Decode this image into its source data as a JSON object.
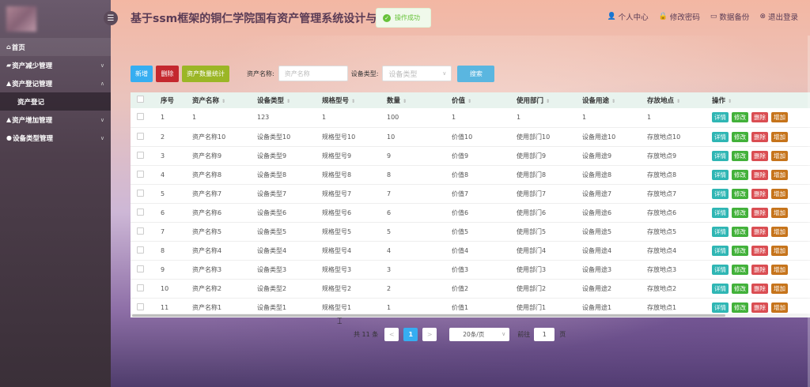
{
  "app": {
    "title": "基于ssm框架的铜仁学院国有资产管理系统设计与实现"
  },
  "toast": {
    "message": "操作成功"
  },
  "header_links": [
    {
      "icon": "user-icon",
      "label": "个人中心"
    },
    {
      "icon": "lock-icon",
      "label": "修改密码"
    },
    {
      "icon": "folder-icon",
      "label": "数据备份"
    },
    {
      "icon": "logout-icon",
      "label": "退出登录"
    }
  ],
  "sidebar": {
    "items": [
      {
        "label": "首页"
      },
      {
        "label": "资产减少管理"
      },
      {
        "label": "资产登记管理"
      },
      {
        "label": "资产登记"
      },
      {
        "label": "资产增加管理"
      },
      {
        "label": "设备类型管理"
      }
    ]
  },
  "toolbar": {
    "add_label": "新增",
    "delete_label": "删除",
    "stat_label": "资产数量统计",
    "name_label": "资产名称:",
    "name_placeholder": "资产名称",
    "type_label": "设备类型:",
    "type_placeholder": "设备类型",
    "search_label": "搜索"
  },
  "table": {
    "columns": [
      "序号",
      "资产名称",
      "设备类型",
      "规格型号",
      "数量",
      "价值",
      "使用部门",
      "设备用途",
      "存放地点",
      "操作"
    ],
    "actions": [
      "详情",
      "修改",
      "删除",
      "增加"
    ],
    "rows": [
      [
        "1",
        "1",
        "123",
        "1",
        "100",
        "1",
        "1",
        "1",
        "1"
      ],
      [
        "2",
        "资产名称10",
        "设备类型10",
        "规格型号10",
        "10",
        "价值10",
        "使用部门10",
        "设备用途10",
        "存放地点10"
      ],
      [
        "3",
        "资产名称9",
        "设备类型9",
        "规格型号9",
        "9",
        "价值9",
        "使用部门9",
        "设备用途9",
        "存放地点9"
      ],
      [
        "4",
        "资产名称8",
        "设备类型8",
        "规格型号8",
        "8",
        "价值8",
        "使用部门8",
        "设备用途8",
        "存放地点8"
      ],
      [
        "5",
        "资产名称7",
        "设备类型7",
        "规格型号7",
        "7",
        "价值7",
        "使用部门7",
        "设备用途7",
        "存放地点7"
      ],
      [
        "6",
        "资产名称6",
        "设备类型6",
        "规格型号6",
        "6",
        "价值6",
        "使用部门6",
        "设备用途6",
        "存放地点6"
      ],
      [
        "7",
        "资产名称5",
        "设备类型5",
        "规格型号5",
        "5",
        "价值5",
        "使用部门5",
        "设备用途5",
        "存放地点5"
      ],
      [
        "8",
        "资产名称4",
        "设备类型4",
        "规格型号4",
        "4",
        "价值4",
        "使用部门4",
        "设备用途4",
        "存放地点4"
      ],
      [
        "9",
        "资产名称3",
        "设备类型3",
        "规格型号3",
        "3",
        "价值3",
        "使用部门3",
        "设备用途3",
        "存放地点3"
      ],
      [
        "10",
        "资产名称2",
        "设备类型2",
        "规格型号2",
        "2",
        "价值2",
        "使用部门2",
        "设备用途2",
        "存放地点2"
      ],
      [
        "11",
        "资产名称1",
        "设备类型1",
        "规格型号1",
        "1",
        "价值1",
        "使用部门1",
        "设备用途1",
        "存放地点1"
      ]
    ]
  },
  "pagination": {
    "total_text": "共 11 条",
    "prev": "<",
    "current_page": "1",
    "next": ">",
    "page_size": "20条/页",
    "goto_label": "前往",
    "goto_value": "1",
    "page_unit": "页"
  }
}
